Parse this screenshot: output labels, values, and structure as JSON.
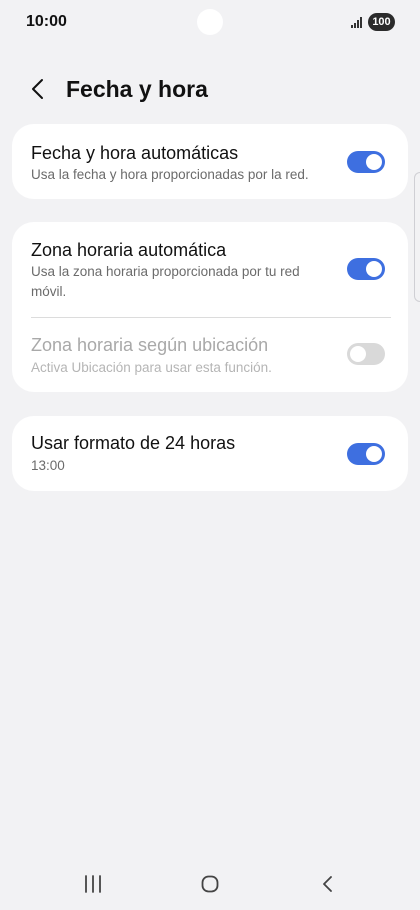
{
  "status_bar": {
    "time": "10:00",
    "battery": "100",
    "signal_icon": "signal-bars-icon"
  },
  "header": {
    "title": "Fecha y hora",
    "back_icon": "chevron-left-icon"
  },
  "settings": {
    "auto_datetime": {
      "title": "Fecha y hora automáticas",
      "subtitle": "Usa la fecha y hora proporcionadas por la red.",
      "enabled": true
    },
    "auto_timezone": {
      "title": "Zona horaria automática",
      "subtitle": "Usa la zona horaria proporcionada por tu red móvil.",
      "enabled": true
    },
    "location_timezone": {
      "title": "Zona horaria según ubicación",
      "subtitle": "Activa Ubicación para usar esta función.",
      "enabled": false,
      "disabled": true
    },
    "format_24h": {
      "title": "Usar formato de 24 horas",
      "subtitle": "13:00",
      "enabled": true
    }
  },
  "nav_bar": {
    "recent_icon": "recent-apps-icon",
    "home_icon": "home-icon",
    "back_icon": "back-icon"
  },
  "colors": {
    "background": "#f2f2f4",
    "card": "#ffffff",
    "accent": "#3e6fe0",
    "toggle_off": "#d9d9d9",
    "primary_text": "#111111",
    "secondary_text": "#6b6b6b",
    "disabled_text": "#a9a9a9"
  }
}
